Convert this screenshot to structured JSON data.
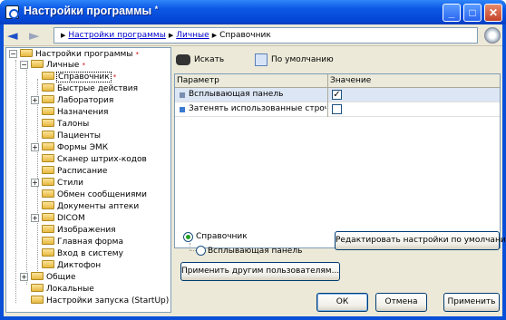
{
  "window": {
    "title": "Настройки программы",
    "title_mark": "*"
  },
  "breadcrumb": {
    "items": [
      "Настройки программы",
      "Личные"
    ],
    "current": "Справочник"
  },
  "tree": {
    "root": "Настройки программы",
    "personal": "Личные",
    "items": [
      "Справочник",
      "Быстрые действия",
      "Лаборатория",
      "Назначения",
      "Талоны",
      "Пациенты",
      "Формы ЭМК",
      "Сканер штрих-кодов",
      "Расписание",
      "Стили",
      "Обмен сообщениями",
      "Документы аптеки",
      "DICOM",
      "Изображения",
      "Главная форма",
      "Вход в систему",
      "Диктофон"
    ],
    "common": "Общие",
    "local": "Локальные",
    "startup": "Настройки запуска (StartUp)",
    "mark": "*"
  },
  "toolbar": {
    "search": "Искать",
    "default": "По умолчанию"
  },
  "grid": {
    "headers": {
      "param": "Параметр",
      "value": "Значение"
    },
    "rows": [
      {
        "name": "Всплывающая панель",
        "checked": true
      },
      {
        "name": "Затенять использованные строчки",
        "checked": false
      }
    ],
    "check_glyph": "✓"
  },
  "scope": {
    "selected": "Справочник",
    "child": "Всплывающая панель"
  },
  "buttons": {
    "edit_defaults": "Редактировать настройки по умолчанию",
    "apply_others": "Применить другим пользователям...",
    "ok": "ОК",
    "cancel": "Отмена",
    "apply": "Применить"
  },
  "window_buttons": {
    "minimize": "_",
    "maximize": "□",
    "close": "✕"
  },
  "icons": {
    "back": "◄",
    "forward": "►",
    "crumb_sep": "▶",
    "expand": "+",
    "collapse": "−"
  }
}
